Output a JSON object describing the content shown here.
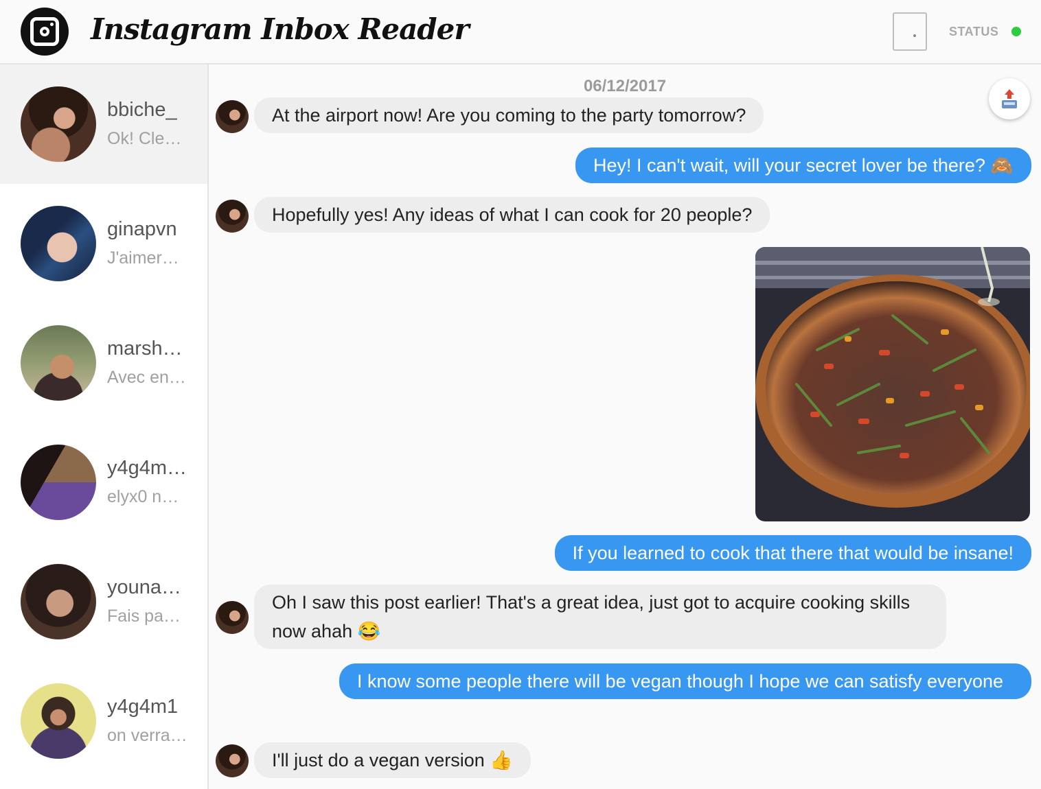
{
  "app": {
    "title": "Instagram Inbox Reader",
    "status_label": "STATUS",
    "status_color": "#2ecc40",
    "accent": "#3897f0"
  },
  "icons": {
    "logo": "instagram-camera-icon",
    "logout": "door-icon",
    "status": "status-dot-icon",
    "upload": "upload-icon"
  },
  "conversations": [
    {
      "name": "bbiche_",
      "preview": "Ok! Cle…",
      "active": true
    },
    {
      "name": "ginapvn",
      "preview": "J'aimer…",
      "active": false
    },
    {
      "name": "marsh…",
      "preview": "Avec en…",
      "active": false
    },
    {
      "name": "y4g4m…",
      "preview": "elyx0 na…",
      "active": false
    },
    {
      "name": "youna…",
      "preview": "Fais pa…",
      "active": false
    },
    {
      "name": "y4g4m1",
      "preview": "on verra…",
      "active": false
    }
  ],
  "chat": {
    "date": "06/12/2017",
    "messages": [
      {
        "from": "them",
        "text": "At the airport now! Are you coming to the party tomorrow?"
      },
      {
        "from": "me",
        "text": "Hey! I can't wait, will your secret lover be there? 🙈"
      },
      {
        "from": "them",
        "text": "Hopefully yes! Any ideas of what I can cook for 20 people?"
      },
      {
        "from": "me",
        "type": "image",
        "text": ""
      },
      {
        "from": "me",
        "text": "If you learned to cook that there that would be insane!"
      },
      {
        "from": "them",
        "text": "Oh I saw this post earlier! That's a great idea, just got to acquire cooking skills now ahah 😂"
      },
      {
        "from": "me",
        "text": "I know some people there will be vegan though I hope we can satisfy everyone"
      },
      {
        "from": "them",
        "text": "I'll just do a vegan version 👍"
      }
    ]
  }
}
